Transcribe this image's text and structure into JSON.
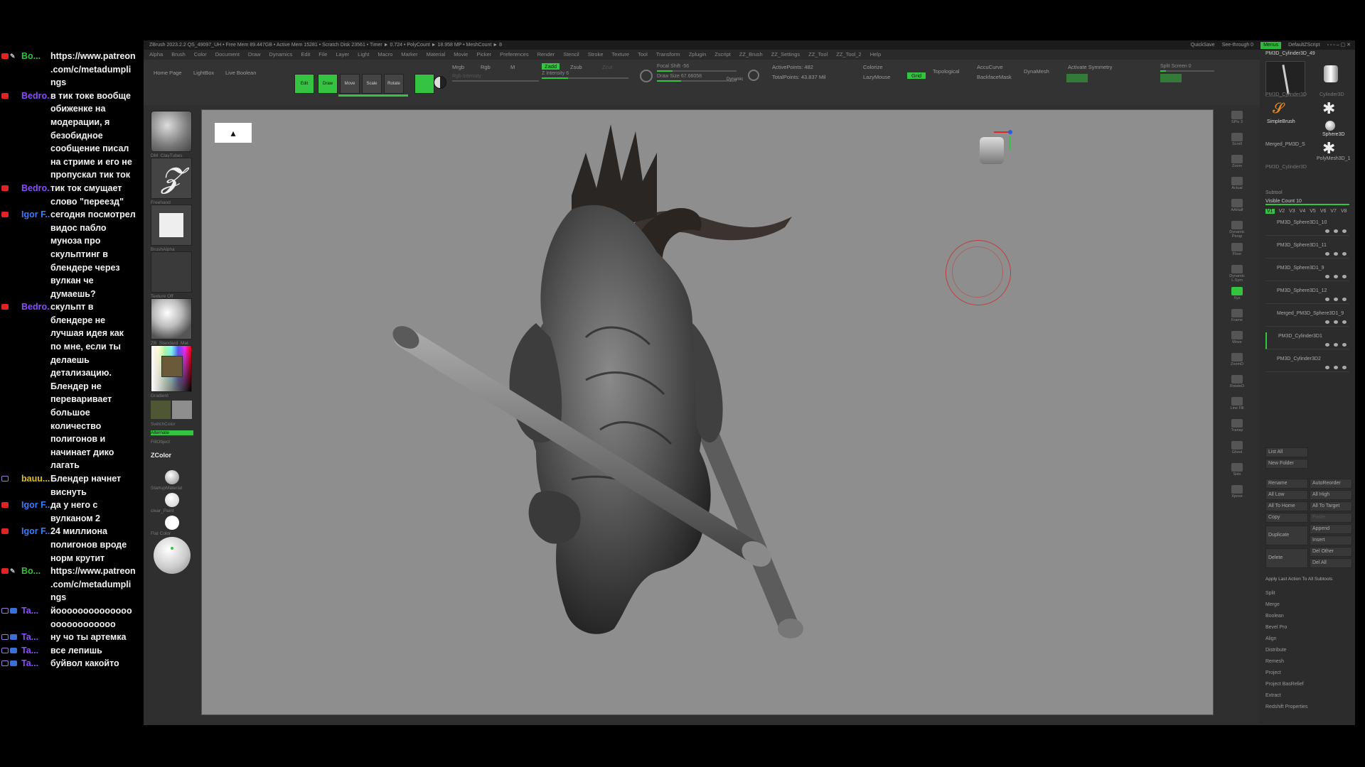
{
  "chat": {
    "messages": [
      {
        "badges": [
          "red",
          "wrench"
        ],
        "user": "Bo...",
        "user_color": "#31c23c",
        "text": "https://www.patreon.com/c/metadumplings"
      },
      {
        "badges": [
          "red"
        ],
        "user": "Bedro...",
        "user_color": "#8a4dff",
        "text": "в тик токе вообще обиженке на модерации, я безобидное сообщение писал на стриме и его не пропускал тик ток"
      },
      {
        "badges": [
          "red"
        ],
        "user": "Bedro...",
        "user_color": "#8a4dff",
        "text": "тик ток смущает слово \"переезд\""
      },
      {
        "badges": [
          "red"
        ],
        "user": "Igor F...",
        "user_color": "#3a7bff",
        "text": "сегодня посмотрел видос пабло муноза про скульптинг в блендере через вулкан че думаешь?"
      },
      {
        "badges": [
          "red"
        ],
        "user": "Bedro...",
        "user_color": "#8a4dff",
        "text": "скульпт в блендере не лучшая идея как по мне, если ты делаешь детализацию. Блендер не переваривает большое количество полигонов и начинает дико лагать"
      },
      {
        "badges": [
          "purple"
        ],
        "user": "bauu...",
        "user_color": "#e0c020",
        "text": "Блендер начнет виснуть"
      },
      {
        "badges": [
          "red"
        ],
        "user": "Igor F...",
        "user_color": "#3a7bff",
        "text": "да у него с вулканом 2"
      },
      {
        "badges": [
          "red"
        ],
        "user": "Igor F...",
        "user_color": "#3a7bff",
        "text": "24 миллиона полигонов вроде норм крутит"
      },
      {
        "badges": [
          "red",
          "wrench"
        ],
        "user": "Bo...",
        "user_color": "#31c23c",
        "text": "https://www.patreon.com/c/metadumplings"
      },
      {
        "badges": [
          "purple",
          "blue"
        ],
        "user": "Ta...",
        "user_color": "#8a4dff",
        "text": "йоооооооооооооооооооооооооо"
      },
      {
        "badges": [
          "purple",
          "blue"
        ],
        "user": "Ta...",
        "user_color": "#8a4dff",
        "text": "ну чо ты артемка"
      },
      {
        "badges": [
          "purple",
          "blue"
        ],
        "user": "Ta...",
        "user_color": "#8a4dff",
        "text": "все лепишь"
      },
      {
        "badges": [
          "purple",
          "blue"
        ],
        "user": "Ta...",
        "user_color": "#8a4dff",
        "text": "буйвол какойто"
      }
    ]
  },
  "app": {
    "title": "ZBrush 2023.2.2   QS_49097_UH   • Free Mem 89.447GB • Active Mem 15281 • Scratch Disk 23561 • Timer ► 0.724 • PolyCount ► 18.958 MP • MeshCount ► 8",
    "quicksave": "QuickSave",
    "see_through": "See-through  0",
    "menus_label": "Menus",
    "default_script": "DefaultZScript",
    "menus": [
      "Alpha",
      "Brush",
      "Color",
      "Document",
      "Draw",
      "Dynamics",
      "Edit",
      "File",
      "Layer",
      "Light",
      "Macro",
      "Marker",
      "Material",
      "Movie",
      "Picker",
      "Preferences",
      "Render",
      "Stencil",
      "Stroke",
      "Texture",
      "Tool",
      "Transform",
      "Zplugin",
      "Zscript",
      "ZZ_Brush",
      "ZZ_Settings",
      "ZZ_Tool",
      "ZZ_Tool_2",
      "Help"
    ]
  },
  "toolbar": {
    "home_page": "Home Page",
    "lightbox": "LightBox",
    "live_boolean": "Live Boolean",
    "modes": [
      {
        "label": "Edit",
        "on": true
      },
      {
        "label": "Draw",
        "on": true
      },
      {
        "label": "Move",
        "on": false
      },
      {
        "label": "Scale",
        "on": false
      },
      {
        "label": "Rotate",
        "on": false
      }
    ],
    "mrgb": "Mrgb",
    "rgb": "Rgb",
    "m": "M",
    "rgb_intensity": "Rgb Intensity",
    "zadd": "Zadd",
    "zsub": "Zsub",
    "zcut": "Zcut",
    "z_intensity": "Z Intensity  6",
    "focal_shift": "Focal Shift  -56",
    "draw_size": "Draw Size  67.66058",
    "dynamic": "Dynamic",
    "active_points": "ActivePoints: 482",
    "total_points": "TotalPoints: 43.837 Mil",
    "colorize": "Colorize",
    "lazymouse": "LazyMouse",
    "grid": "Grid",
    "topological": "Topological",
    "accucurve": "AccuCurve",
    "backface_mask": "BackfaceMask",
    "dynamesh": "DynaMesh",
    "activate_symmetry": "Activate Symmetry",
    "split_screen": "Split Screen  0"
  },
  "left_tray": {
    "brush_label": "DM_ClayTubes",
    "stroke_label": "Freehand",
    "alpha_label": "BrushAlpha",
    "texture_label": "Texture Off",
    "material_label": "ZB_Standard_Mat",
    "gradient_label": "Gradient",
    "switch_color": "SwitchColor",
    "alternate": "Alternate",
    "fill_object": "FillObject",
    "zcolor": "ZColor",
    "startup_material": "StartupMaterial",
    "clear_paint": "clear_Paint",
    "flat_color": "Flat Color"
  },
  "right_shelf": [
    {
      "label": "SPix 3"
    },
    {
      "label": "Scroll"
    },
    {
      "label": "Zoom"
    },
    {
      "label": "Actual"
    },
    {
      "label": "AAHalf"
    },
    {
      "label": "Dynamic Persp"
    },
    {
      "label": "Floor"
    },
    {
      "label": "Dynamic L.Sym"
    },
    {
      "label": "Xyz"
    },
    {
      "label": "Frame"
    },
    {
      "label": "Move"
    },
    {
      "label": "ZoomD"
    },
    {
      "label": "RotateD"
    },
    {
      "label": "Line Fill"
    },
    {
      "label": "Transp"
    },
    {
      "label": "Ghost"
    },
    {
      "label": "Solo"
    },
    {
      "label": "Xpose"
    }
  ],
  "palette": {
    "tool_name": "PM3D_Cylinder3D_49",
    "tools": [
      "PM3D_Cylinder3D",
      "Cylinder3D",
      "PolyMesh3D",
      "SimpleBrush",
      "Sphere3D",
      "Merged_PM3D_S",
      "PolyMesh3D_1",
      "PM3D_Cylinder3D"
    ],
    "subtool_header": "Subtool",
    "visible_count": "Visible Count  10",
    "subtools": [
      "PM3D_Sphere3D1_10",
      "PM3D_Sphere3D1_11",
      "PM3D_Sphere3D1_9",
      "PM3D_Sphere3D1_12",
      "Merged_PM3D_Sphere3D1_9",
      "PM3D_Cylinder3D1",
      "PM3D_Cylinder3D2"
    ],
    "list_all": "List All",
    "new_folder": "New Folder",
    "rename": "Rename",
    "autoreorder": "AutoReorder",
    "all_low": "All Low",
    "all_high": "All High",
    "all_to_home": "All To Home",
    "all_to_target": "All To Target",
    "copy": "Copy",
    "paste": "Paste",
    "duplicate": "Duplicate",
    "append": "Append",
    "insert": "Insert",
    "delete": "Delete",
    "del_other": "Del Other",
    "del_all": "Del All",
    "apply_last": "Apply Last Action To All Subtools",
    "actions": [
      "Split",
      "Merge",
      "Boolean",
      "Bevel Pro",
      "Align",
      "Distribute",
      "Remesh",
      "Project",
      "Project BasRelief",
      "Extract",
      "Redshift Properties"
    ]
  },
  "colors": {
    "accent_green": "#35c442",
    "canvas_bg": "#8e8e8e",
    "ui_bg": "#2f2f2f"
  }
}
